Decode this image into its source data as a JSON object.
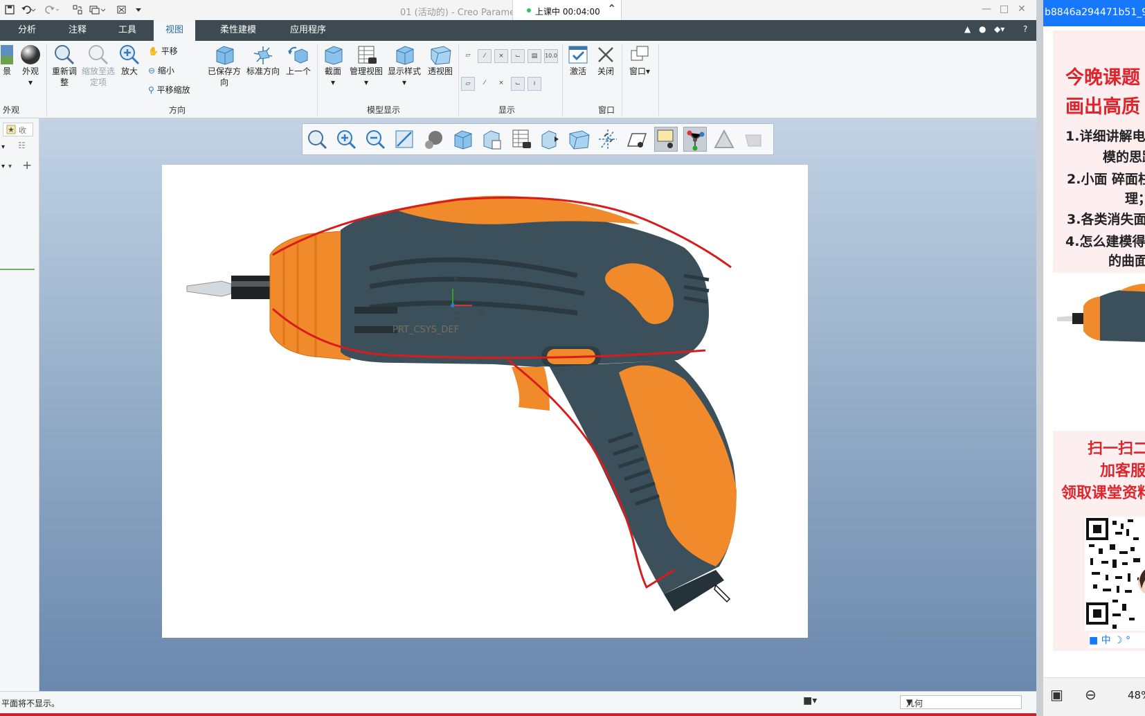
{
  "titlebar": {
    "title": "01 (活动的) - Creo Parame",
    "live_status": "上课中 00:04:00"
  },
  "ribbon_tabs": [
    {
      "label": "分析",
      "active": false
    },
    {
      "label": "注释",
      "active": false
    },
    {
      "label": "工具",
      "active": false
    },
    {
      "label": "视图",
      "active": true
    },
    {
      "label": "柔性建模",
      "active": false
    },
    {
      "label": "应用程序",
      "active": false
    }
  ],
  "ribbon": {
    "appearance": {
      "gallery_label": "景",
      "appearance_label": "外观",
      "group_label": "外观"
    },
    "orientation": {
      "refit": "重新调整",
      "zoom_to_selected": "缩放至选定项",
      "zoom_in": "放大",
      "pan": "平移",
      "zoom_out": "缩小",
      "pan_zoom": "平移缩放",
      "saved_orientations": "已保存方向",
      "standard_orientation": "标准方向",
      "previous": "上一个",
      "group_label": "方向"
    },
    "model_display": {
      "section": "截面",
      "manage_views": "管理视图",
      "display_style": "显示样式",
      "perspective": "透视图",
      "group_label": "模型显示"
    },
    "show": {
      "group_label": "显示",
      "badge": "10.0"
    },
    "window": {
      "activate": "激活",
      "close": "关闭",
      "window": "窗口",
      "group_label": "窗口"
    }
  },
  "left_panel": {
    "tab_label": "收"
  },
  "canvas": {
    "csys_label": "PRT_CSYS_DEF",
    "axis_x": "X",
    "axis_y": "Y",
    "axis_z": "Z"
  },
  "statusbar": {
    "message": "平面将不显示。",
    "filter_value": "几何"
  },
  "side_panel": {
    "header": "b8846a294471b51_9",
    "headline_1": "今晚课题",
    "headline_2": "画出高质",
    "points": [
      "1.详细讲解电",
      "模的思路",
      "2.小面 碎面柱",
      "理；",
      "3.各类消失面",
      "4.怎么建模得",
      "的曲面"
    ],
    "cta_1": "扫一扫二",
    "cta_2": "加客服领",
    "cta_3": "领取课堂资料",
    "zoom": "48%"
  },
  "colors": {
    "tab_bar": "#3e4a51",
    "active_tab_text": "#2d6b96",
    "ribbon_bg": "#f4f6f8",
    "drill_orange": "#f07e1e",
    "drill_body": "#3a4f58",
    "sketch_red": "#d81c1c",
    "side_header": "#1677ff",
    "side_headline": "#e0242b"
  },
  "icons": {
    "save": "save-icon",
    "undo": "undo-icon",
    "redo": "redo-icon",
    "regenerate": "regenerate-icon",
    "windows": "windows-icon",
    "close_small": "close-small-icon",
    "customize": "chevron-down-icon"
  }
}
